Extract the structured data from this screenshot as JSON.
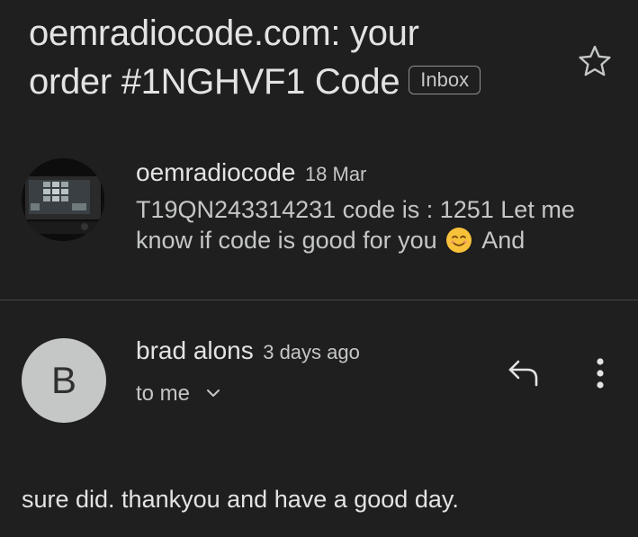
{
  "subject": {
    "line1": "oemradiocode.com: your",
    "line2": "order #1NGHVF1 Code",
    "label_chip": "Inbox"
  },
  "icons": {
    "star": "star-outline-icon",
    "reply": "reply-icon",
    "more": "more-vertical-icon",
    "emoji": "smiling-face-emoji",
    "chevron": "chevron-down-icon"
  },
  "messages": [
    {
      "sender": "oemradiocode",
      "date": "18 Mar",
      "snippet_before_emoji": "T19QN243314231 code is : 1251 Let me know if code is good for you",
      "snippet_after_emoji": "And",
      "avatar": "photo"
    },
    {
      "sender": "brad alons",
      "date": "3 days ago",
      "recipient": "to me",
      "avatar_letter": "B",
      "body": "sure did. thankyou and have a good day."
    }
  ],
  "colors": {
    "background": "#1f1f1f",
    "primary_text": "#e3e3e3",
    "secondary_text": "#c4c7c5",
    "divider": "#444746",
    "avatar_bg": "#c4c7c5"
  }
}
